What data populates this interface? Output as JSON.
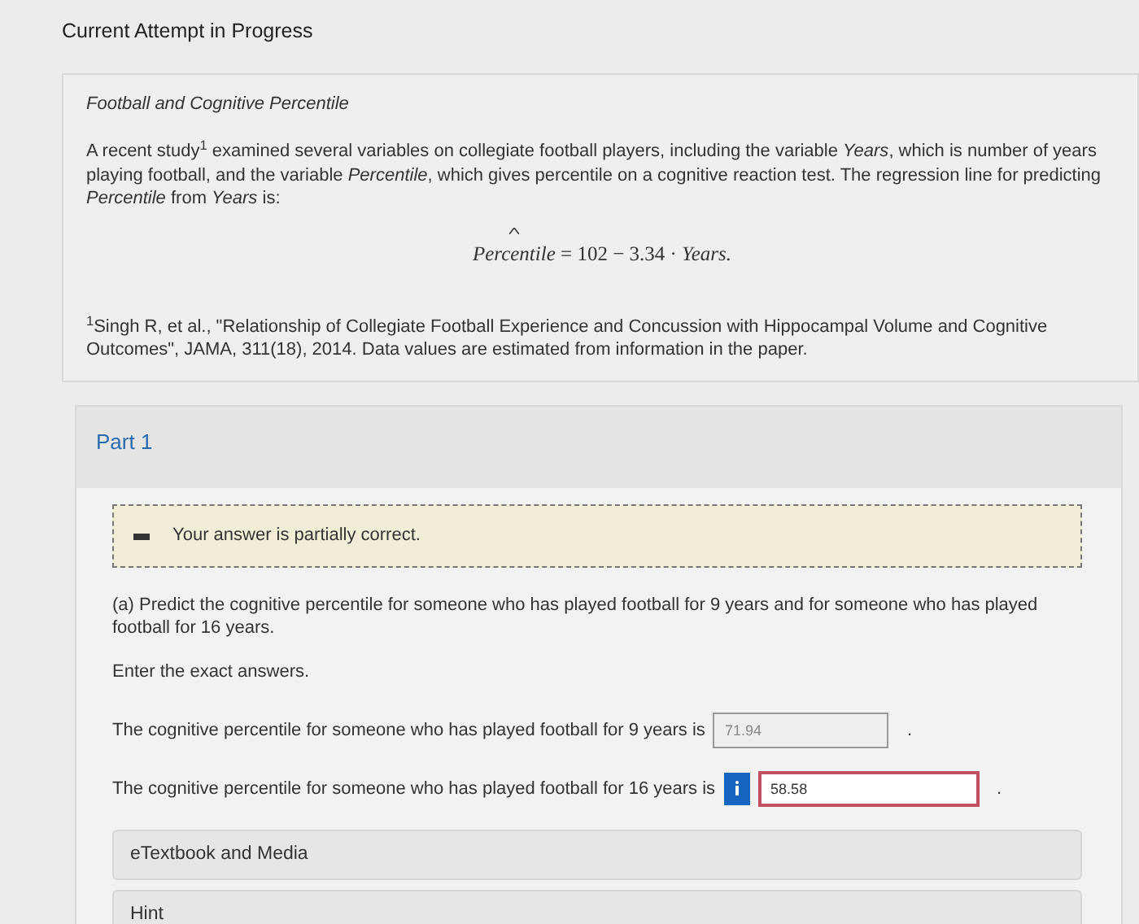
{
  "heading": "Current Attempt in Progress",
  "problem": {
    "title": "Football and Cognitive Percentile",
    "intro": "A recent study$^{1}$ examined several variables on collegiate football players, including the variable *Years*, which is number of years playing football, and the variable *Percentile*, which gives percentile on a cognitive reaction test. The regression line for predicting *Percentile* from *Years* is:",
    "formula": {
      "lhs": "Percentile",
      "rhs": "= 102 − 3.34 · *Years.*"
    },
    "footnote": "$^{1}$Singh R, et al., \"Relationship of Collegiate Football Experience and Concussion with Hippocampal Volume and Cognitive Outcomes\", JAMA, 311(18), 2014. Data values are estimated from information in the paper."
  },
  "part": {
    "title": "Part 1",
    "feedback": {
      "kind": "partial",
      "text": "Your answer is partially correct."
    },
    "question": "(a) Predict the cognitive percentile for someone who has played football for 9 years and for someone who has played football for 16 years.",
    "instruction": "Enter the exact answers.",
    "answers": [
      {
        "label": "The cognitive percentile for someone who has played football for 9 years is",
        "value": "71.94",
        "correct": true,
        "suffix": "."
      },
      {
        "label": "The cognitive percentile for someone who has played football for 16 years is",
        "value": "58.58",
        "correct": false,
        "suffix": "."
      }
    ],
    "resources": [
      "eTextbook and Media",
      "Hint"
    ]
  }
}
